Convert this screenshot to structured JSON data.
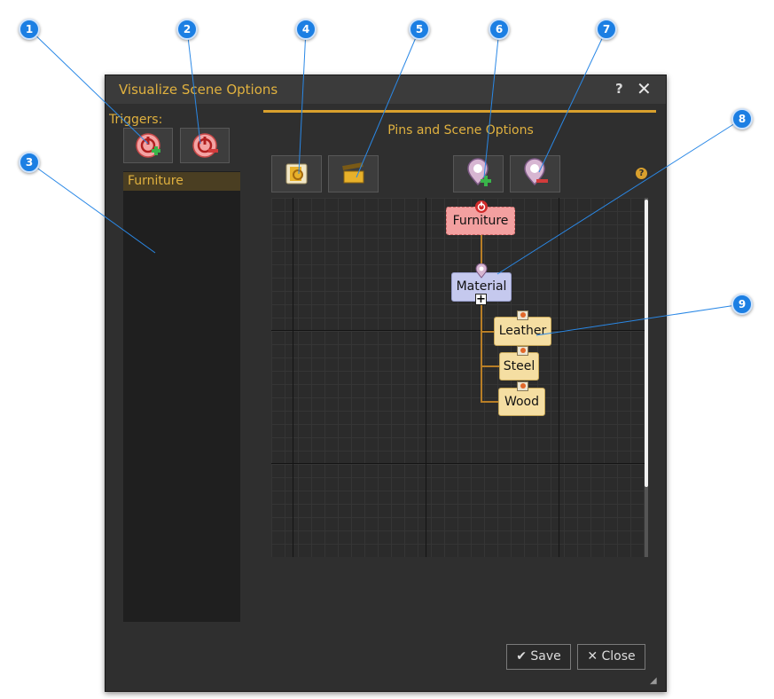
{
  "dialog": {
    "title": "Visualize Scene Options",
    "help_label": "?",
    "close_glyph": "✕"
  },
  "triggers": {
    "label": "Triggers:",
    "add_icon": "add-trigger-icon",
    "remove_icon": "remove-trigger-icon",
    "list": [
      "Furniture"
    ]
  },
  "pins_panel": {
    "title": "Pins and Scene Options",
    "toolbar_icons": [
      "trigger-settings-icon",
      "scene-clapper-icon",
      "add-pin-icon",
      "remove-pin-icon"
    ],
    "info_label": "?"
  },
  "tree": {
    "root": {
      "label": "Furniture"
    },
    "group": {
      "label": "Material",
      "expander": "+"
    },
    "leaves": [
      "Leather",
      "Steel",
      "Wood"
    ]
  },
  "footer": {
    "save_label": "Save",
    "close_label": "Close"
  },
  "callouts": [
    "1",
    "2",
    "3",
    "4",
    "5",
    "6",
    "7",
    "8",
    "9"
  ],
  "colors": {
    "accent": "#e0b13f",
    "callout": "#1c7fe3",
    "root_node": "#f3a0a0",
    "group_node": "#c5c9ee",
    "leaf_node": "#f5dea2"
  }
}
